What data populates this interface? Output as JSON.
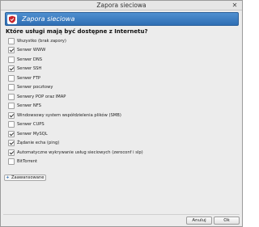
{
  "window": {
    "title": "Zapora sieciowa",
    "close_glyph": "✕"
  },
  "banner": {
    "title": "Zapora sieciowa",
    "icon": "shield-icon"
  },
  "question": "Które usługi mają być dostępne z Internetu?",
  "services": [
    {
      "label": "Wszystko (brak zapory)",
      "checked": false
    },
    {
      "label": "Serwer WWW",
      "checked": true
    },
    {
      "label": "Serwer DNS",
      "checked": false
    },
    {
      "label": "Serwer SSH",
      "checked": true
    },
    {
      "label": "Serwer FTP",
      "checked": false
    },
    {
      "label": "Serwer pocztowy",
      "checked": false
    },
    {
      "label": "Serwery POP oraz IMAP",
      "checked": false
    },
    {
      "label": "Serwer NFS",
      "checked": false
    },
    {
      "label": "Windowsowy system współdzielenia plików (SMB)",
      "checked": true
    },
    {
      "label": "Serwer CUPS",
      "checked": false
    },
    {
      "label": "Serwer MySQL",
      "checked": true
    },
    {
      "label": "Żądanie echa (ping)",
      "checked": true
    },
    {
      "label": "Automatyczne wykrywanie usług sieciowych (zeroconf i slp)",
      "checked": true
    },
    {
      "label": "BitTorrent",
      "checked": false
    }
  ],
  "advanced_label": "Zaawansowane",
  "buttons": {
    "cancel": "Anuluj",
    "ok": "Ok"
  },
  "colors": {
    "banner": "#3a7cc0",
    "banner_text": "#ffffff",
    "shield": "#c8252c"
  }
}
